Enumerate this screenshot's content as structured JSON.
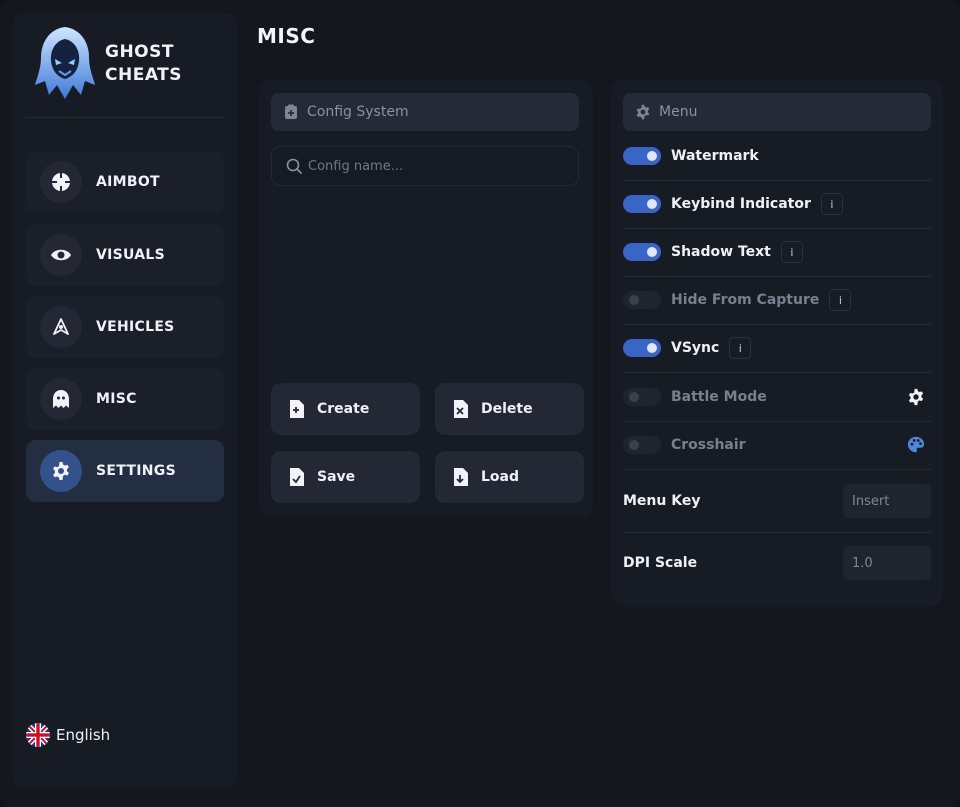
{
  "brand": {
    "line1": "GHOST",
    "line2": "CHEATS"
  },
  "page_title": "MISC",
  "nav": {
    "items": [
      {
        "label": "AIMBOT",
        "icon": "crosshair-icon",
        "active": false
      },
      {
        "label": "VISUALS",
        "icon": "eye-icon",
        "active": false
      },
      {
        "label": "VEHICLES",
        "icon": "vehicle-icon",
        "active": false
      },
      {
        "label": "MISC",
        "icon": "ghost-icon",
        "active": false
      },
      {
        "label": "SETTINGS",
        "icon": "gear-icon",
        "active": true
      }
    ]
  },
  "language": {
    "label": "English",
    "icon": "uk-flag-icon"
  },
  "config": {
    "header": "Config System",
    "input_placeholder": "Config name...",
    "input_value": "",
    "buttons": {
      "create": "Create",
      "delete": "Delete",
      "save": "Save",
      "load": "Load"
    }
  },
  "menu": {
    "header": "Menu",
    "toggles": [
      {
        "label": "Watermark",
        "on": true,
        "info": false
      },
      {
        "label": "Keybind Indicator",
        "on": true,
        "info": true
      },
      {
        "label": "Shadow Text",
        "on": true,
        "info": true
      },
      {
        "label": "Hide From Capture",
        "on": false,
        "info": true
      },
      {
        "label": "VSync",
        "on": true,
        "info": true
      },
      {
        "label": "Battle Mode",
        "on": false,
        "info": false,
        "right_icon": "gear-icon"
      },
      {
        "label": "Crosshair",
        "on": false,
        "info": false,
        "right_icon": "palette-icon"
      }
    ],
    "info_glyph": "i",
    "menu_key": {
      "label": "Menu Key",
      "value": "Insert"
    },
    "dpi_scale": {
      "label": "DPI Scale",
      "value": "1.0"
    }
  },
  "colors": {
    "accent": "#3a64c6",
    "background": "#14171e",
    "panel": "#171b23",
    "palette_icon": "#4f86d8"
  }
}
